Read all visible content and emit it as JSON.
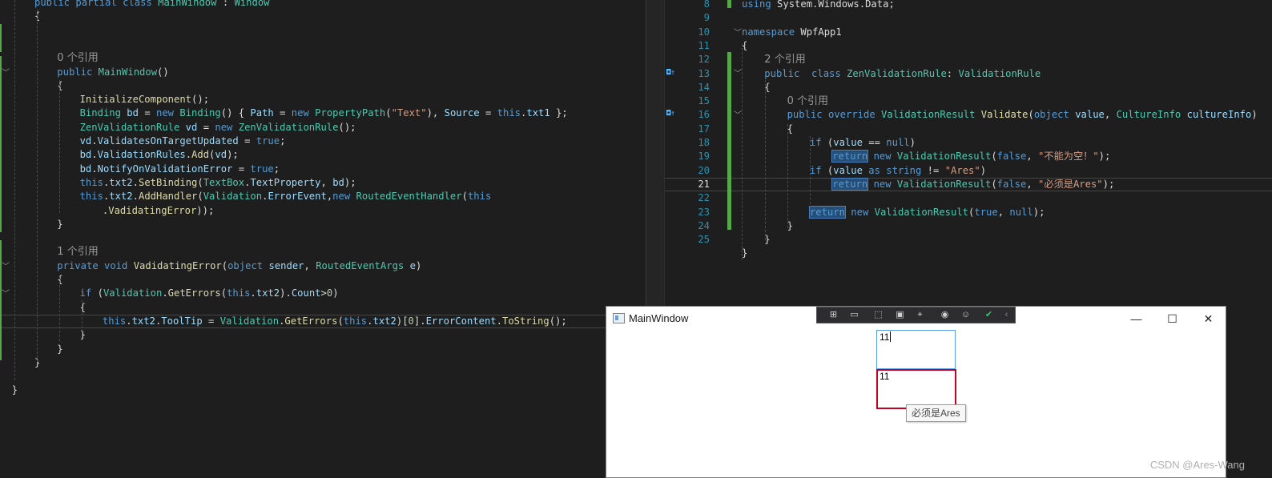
{
  "left_editor": {
    "lines": [
      [
        [
          "kw",
          "public "
        ],
        [
          "kw",
          "partial "
        ],
        [
          "kw",
          "class "
        ],
        [
          "ty",
          "MainWindow"
        ],
        [
          "pl",
          " : "
        ],
        [
          "ty",
          "Window"
        ]
      ],
      [
        [
          "pl",
          "{"
        ]
      ],
      [],
      [],
      [
        [
          "ref",
          "0 个引用"
        ]
      ],
      [
        [
          "kw",
          "public "
        ],
        [
          "ty",
          "MainWindow"
        ],
        [
          "pl",
          "()"
        ]
      ],
      [
        [
          "pl",
          "{"
        ]
      ],
      [
        [
          "fn",
          "InitializeComponent"
        ],
        [
          "pl",
          "();"
        ]
      ],
      [
        [
          "ty",
          "Binding "
        ],
        [
          "var",
          "bd "
        ],
        [
          "pl",
          "= "
        ],
        [
          "kw",
          "new "
        ],
        [
          "ty",
          "Binding"
        ],
        [
          "pl",
          "() { "
        ],
        [
          "var",
          "Path "
        ],
        [
          "pl",
          "= "
        ],
        [
          "kw",
          "new "
        ],
        [
          "ty",
          "PropertyPath"
        ],
        [
          "pl",
          "("
        ],
        [
          "str",
          "\"Text\""
        ],
        [
          "pl",
          "), "
        ],
        [
          "var",
          "Source "
        ],
        [
          "pl",
          "= "
        ],
        [
          "kw",
          "this"
        ],
        [
          "pl",
          "."
        ],
        [
          "var",
          "txt1 "
        ],
        [
          "pl",
          "};"
        ]
      ],
      [
        [
          "ty",
          "ZenValidationRule "
        ],
        [
          "var",
          "vd "
        ],
        [
          "pl",
          "= "
        ],
        [
          "kw",
          "new "
        ],
        [
          "ty",
          "ZenValidationRule"
        ],
        [
          "pl",
          "();"
        ]
      ],
      [
        [
          "var",
          "vd"
        ],
        [
          "pl",
          "."
        ],
        [
          "var",
          "ValidatesOnTargetUpdated "
        ],
        [
          "pl",
          "= "
        ],
        [
          "kw",
          "true"
        ],
        [
          "pl",
          ";"
        ]
      ],
      [
        [
          "var",
          "bd"
        ],
        [
          "pl",
          "."
        ],
        [
          "var",
          "ValidationRules"
        ],
        [
          "pl",
          "."
        ],
        [
          "fn",
          "Add"
        ],
        [
          "pl",
          "("
        ],
        [
          "var",
          "vd"
        ],
        [
          "pl",
          ");"
        ]
      ],
      [
        [
          "var",
          "bd"
        ],
        [
          "pl",
          "."
        ],
        [
          "var",
          "NotifyOnValidationError "
        ],
        [
          "pl",
          "= "
        ],
        [
          "kw",
          "true"
        ],
        [
          "pl",
          ";"
        ]
      ],
      [
        [
          "kw",
          "this"
        ],
        [
          "pl",
          "."
        ],
        [
          "var",
          "txt2"
        ],
        [
          "pl",
          "."
        ],
        [
          "fn",
          "SetBinding"
        ],
        [
          "pl",
          "("
        ],
        [
          "ty",
          "TextBox"
        ],
        [
          "pl",
          "."
        ],
        [
          "var",
          "TextProperty"
        ],
        [
          "pl",
          ", "
        ],
        [
          "var",
          "bd"
        ],
        [
          "pl",
          ");"
        ]
      ],
      [
        [
          "kw",
          "this"
        ],
        [
          "pl",
          "."
        ],
        [
          "var",
          "txt2"
        ],
        [
          "pl",
          "."
        ],
        [
          "fn",
          "AddHandler"
        ],
        [
          "pl",
          "("
        ],
        [
          "ty",
          "Validation"
        ],
        [
          "pl",
          "."
        ],
        [
          "var",
          "ErrorEvent"
        ],
        [
          "pl",
          ","
        ],
        [
          "kw",
          "new "
        ],
        [
          "ty",
          "RoutedEventHandler"
        ],
        [
          "pl",
          "("
        ],
        [
          "kw",
          "this"
        ]
      ],
      [
        [
          "pl",
          "."
        ],
        [
          "fn",
          "VadidatingError"
        ],
        [
          "pl",
          "));"
        ]
      ],
      [
        [
          "pl",
          "}"
        ]
      ],
      [],
      [
        [
          "ref",
          "1 个引用"
        ]
      ],
      [
        [
          "kw",
          "private "
        ],
        [
          "kw",
          "void "
        ],
        [
          "fn",
          "VadidatingError"
        ],
        [
          "pl",
          "("
        ],
        [
          "kw",
          "object "
        ],
        [
          "var",
          "sender"
        ],
        [
          "pl",
          ", "
        ],
        [
          "ty",
          "RoutedEventArgs "
        ],
        [
          "var",
          "e"
        ],
        [
          "pl",
          ")"
        ]
      ],
      [
        [
          "pl",
          "{"
        ]
      ],
      [
        [
          "kw",
          "if "
        ],
        [
          "pl",
          "("
        ],
        [
          "ty",
          "Validation"
        ],
        [
          "pl",
          "."
        ],
        [
          "fn",
          "GetErrors"
        ],
        [
          "pl",
          "("
        ],
        [
          "kw",
          "this"
        ],
        [
          "pl",
          "."
        ],
        [
          "var",
          "txt2"
        ],
        [
          "pl",
          ")."
        ],
        [
          "var",
          "Count"
        ],
        [
          "pl",
          ">"
        ],
        [
          "num",
          "0"
        ],
        [
          "pl",
          ")"
        ]
      ],
      [
        [
          "pl",
          "{"
        ]
      ],
      [
        [
          "kw",
          "this"
        ],
        [
          "pl",
          "."
        ],
        [
          "var",
          "txt2"
        ],
        [
          "pl",
          "."
        ],
        [
          "var",
          "ToolTip "
        ],
        [
          "pl",
          "= "
        ],
        [
          "ty",
          "Validation"
        ],
        [
          "pl",
          "."
        ],
        [
          "fn",
          "GetErrors"
        ],
        [
          "pl",
          "("
        ],
        [
          "kw",
          "this"
        ],
        [
          "pl",
          "."
        ],
        [
          "var",
          "txt2"
        ],
        [
          "pl",
          ")["
        ],
        [
          "num",
          "0"
        ],
        [
          "pl",
          "]."
        ],
        [
          "var",
          "ErrorContent"
        ],
        [
          "pl",
          "."
        ],
        [
          "fn",
          "ToString"
        ],
        [
          "pl",
          "();"
        ]
      ],
      [
        [
          "pl",
          "}"
        ]
      ],
      [
        [
          "pl",
          "}"
        ]
      ],
      [
        [
          "pl",
          "}"
        ]
      ],
      [],
      [
        [
          "pl",
          "}"
        ]
      ]
    ]
  },
  "right_editor": {
    "line_numbers": [
      "8",
      "9",
      "10",
      "11",
      "12",
      "13",
      "14",
      "15",
      "16",
      "17",
      "18",
      "19",
      "20",
      "21",
      "22",
      "23",
      "24",
      "25"
    ],
    "active_line": "21",
    "lines": [
      [
        [
          "kw",
          "using "
        ],
        [
          "pl",
          "System.Windows.Data;"
        ]
      ],
      [],
      [
        [
          "kw",
          "namespace "
        ],
        [
          "pl",
          "WpfApp1"
        ]
      ],
      [
        [
          "pl",
          "{"
        ]
      ],
      [
        [
          "ref",
          "2 个引用"
        ]
      ],
      [
        [
          "kw",
          "public "
        ],
        [
          "pl",
          " "
        ],
        [
          "kw",
          "class "
        ],
        [
          "ty",
          "ZenValidationRule"
        ],
        [
          "pl",
          ": "
        ],
        [
          "ty",
          "ValidationRule"
        ]
      ],
      [
        [
          "pl",
          "{"
        ]
      ],
      [
        [
          "ref",
          "0 个引用"
        ]
      ],
      [
        [
          "kw",
          "public "
        ],
        [
          "kw",
          "override "
        ],
        [
          "ty",
          "ValidationResult "
        ],
        [
          "fn",
          "Validate"
        ],
        [
          "pl",
          "("
        ],
        [
          "kw",
          "object "
        ],
        [
          "var",
          "value"
        ],
        [
          "pl",
          ", "
        ],
        [
          "ty",
          "CultureInfo "
        ],
        [
          "var",
          "cultureInfo"
        ],
        [
          "pl",
          ")"
        ]
      ],
      [
        [
          "pl",
          "{"
        ]
      ],
      [
        [
          "kw",
          "if "
        ],
        [
          "pl",
          "("
        ],
        [
          "var",
          "value "
        ],
        [
          "pl",
          "== "
        ],
        [
          "kw",
          "null"
        ],
        [
          "pl",
          ")"
        ]
      ],
      [
        [
          "kwh",
          "return"
        ],
        [
          "pl",
          " "
        ],
        [
          "kw",
          "new "
        ],
        [
          "ty",
          "ValidationResult"
        ],
        [
          "pl",
          "("
        ],
        [
          "kw",
          "false"
        ],
        [
          "pl",
          ", "
        ],
        [
          "str",
          "\"不能为空！\""
        ],
        [
          "pl",
          ");"
        ]
      ],
      [
        [
          "kw",
          "if "
        ],
        [
          "pl",
          "("
        ],
        [
          "var",
          "value "
        ],
        [
          "kw",
          "as "
        ],
        [
          "kw",
          "string "
        ],
        [
          "pl",
          "!= "
        ],
        [
          "str",
          "\"Ares\""
        ],
        [
          "pl",
          ")"
        ]
      ],
      [
        [
          "kwh",
          "return"
        ],
        [
          "pl",
          " "
        ],
        [
          "kw",
          "new "
        ],
        [
          "ty",
          "ValidationResult"
        ],
        [
          "pl",
          "("
        ],
        [
          "kw",
          "false"
        ],
        [
          "pl",
          ", "
        ],
        [
          "str",
          "\"必须是Ares\""
        ],
        [
          "pl",
          ");"
        ]
      ],
      [],
      [
        [
          "kwh",
          "return"
        ],
        [
          "pl",
          " "
        ],
        [
          "kw",
          "new "
        ],
        [
          "ty",
          "ValidationResult"
        ],
        [
          "pl",
          "("
        ],
        [
          "kw",
          "true"
        ],
        [
          "pl",
          ", "
        ],
        [
          "kw",
          "null"
        ],
        [
          "pl",
          ");"
        ]
      ],
      [
        [
          "pl",
          "}"
        ]
      ],
      [
        [
          "pl",
          "}"
        ]
      ],
      [
        [
          "pl",
          "}"
        ]
      ]
    ]
  },
  "app_window": {
    "title": "MainWindow",
    "txt1_value": "11",
    "txt2_value": "11",
    "tooltip": "必须是Ares",
    "minimize_glyph": "—",
    "maximize_glyph": "☐",
    "close_glyph": "✕"
  },
  "watermark": "CSDN @Ares-Wang",
  "colors": {
    "editor_bg": "#1e1e1e",
    "keyword": "#569cd6",
    "type": "#4ec9b0",
    "method": "#dcdcaa",
    "variable": "#9cdcfe",
    "string": "#d69d85",
    "change_bar": "#57a64a",
    "error_border": "#c40024",
    "focus_border": "#569de5"
  }
}
